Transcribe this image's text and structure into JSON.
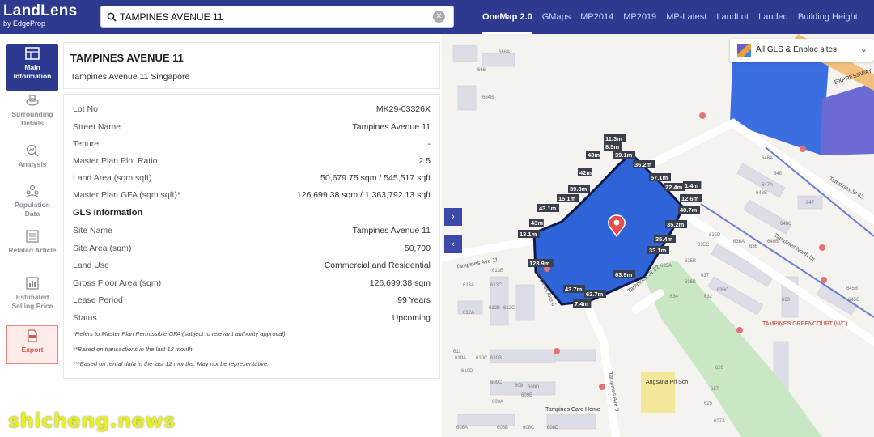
{
  "brand": {
    "title": "LandLens",
    "subtitle": "by EdgeProp"
  },
  "search": {
    "value": "TAMPINES AVENUE 11"
  },
  "nav_tabs": [
    "OneMap 2.0",
    "GMaps",
    "MP2014",
    "MP2019",
    "MP-Latest",
    "LandLot",
    "Landed",
    "Building Height"
  ],
  "rail": {
    "items": [
      {
        "label": "Main Information",
        "icon": "map-icon"
      },
      {
        "label": "Surrounding Details",
        "icon": "neighborhood-icon"
      },
      {
        "label": "Analysis",
        "icon": "chart-search-icon"
      },
      {
        "label": "Population Data",
        "icon": "people-icon"
      },
      {
        "label": "Related Article",
        "icon": "newspaper-icon"
      },
      {
        "label": "Estimated Selling Price",
        "icon": "price-chart-icon"
      },
      {
        "label": "Export",
        "icon": "pdf-icon"
      }
    ]
  },
  "panel": {
    "title": "TAMPINES AVENUE 11",
    "subtitle": "Tampines Avenue 11 Singapore",
    "rows": [
      {
        "k": "Lot No",
        "v": "MK29-03326X"
      },
      {
        "k": "Street Name",
        "v": "Tampines Avenue 11"
      },
      {
        "k": "Tenure",
        "v": "-"
      },
      {
        "k": "Master Plan Plot Ratio",
        "v": "2.5"
      },
      {
        "k": "Land Area (sqm sqft)",
        "v": "50,679.75 sqm / 545,517 sqft"
      },
      {
        "k": "Master Plan GFA (sqm sqft)*",
        "v": "126,699.38 sqm / 1,363,792.13 sqft"
      }
    ],
    "gls_heading": "GLS Information",
    "gls_rows": [
      {
        "k": "Site Name",
        "v": "Tampines Avenue 11"
      },
      {
        "k": "Site Area (sqm)",
        "v": "50,700"
      },
      {
        "k": "Land Use",
        "v": "Commercial and Residential"
      },
      {
        "k": "Gross Floor Area (sqm)",
        "v": "126,699.38 sqm"
      },
      {
        "k": "Lease Period",
        "v": "99 Years"
      },
      {
        "k": "Status",
        "v": "Upcoming"
      }
    ],
    "notes": [
      "*Refers to Master Plan Permissible GFA (subject to relevant authority approval).",
      "**Based on transactions in the last 12 month.",
      "***Based on rental data in the last 12 months. May not be representative."
    ]
  },
  "map": {
    "layer_select": "All GLS & Enbloc sites",
    "site_color": "#2f64d8",
    "measurements": [
      "11.3m",
      "8.5m",
      "39.1m",
      "43m",
      "36.2m",
      "42m",
      "57.1m",
      "22.4m",
      "1.4m",
      "39.8m",
      "12.6m",
      "15.1m",
      "40.7m",
      "43.1m",
      "35.2m",
      "43m",
      "35.4m",
      "13.1m",
      "33.1m",
      "128.9m",
      "63.9m",
      "43.7m",
      "63.7m",
      "7.4m"
    ],
    "road_labels": [
      "Tampines Ave 11",
      "Tampines St 62",
      "Tampines North Dr",
      "Tampines Ave 9",
      "Tampines Ave 6",
      "Tampines St 32"
    ],
    "place_labels": [
      "TAMPINES GREENCOURT (U/C)",
      "Angsana Pri Sch",
      "Tampines Care Home",
      "EXPRESSWAY"
    ],
    "block_labels": [
      "666A",
      "666",
      "664B",
      "648A",
      "648",
      "647A",
      "647",
      "648B",
      "648C",
      "646B",
      "635D",
      "636A",
      "635C",
      "636",
      "635B",
      "635A",
      "637",
      "636C",
      "636B",
      "633",
      "634",
      "632",
      "645B",
      "645C",
      "613B",
      "613C",
      "613A",
      "612B",
      "612C",
      "612A",
      "611",
      "610B",
      "610C",
      "610A",
      "610D",
      "609",
      "609C",
      "609B",
      "609A",
      "609D",
      "608A",
      "608B",
      "608C",
      "608D",
      "626",
      "627",
      "627A",
      "625"
    ]
  },
  "watermark": "shicheng.news"
}
